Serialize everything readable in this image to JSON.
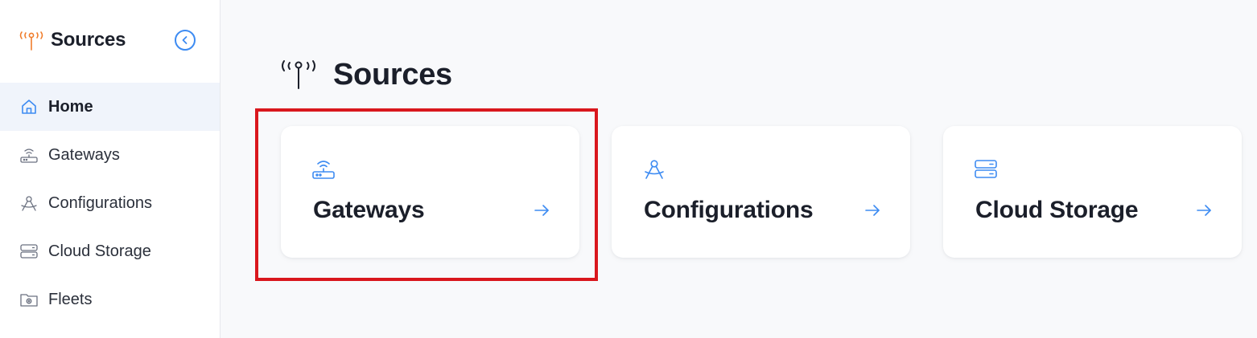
{
  "sidebar": {
    "title": "Sources",
    "logo_icon": "antenna-icon",
    "collapse_icon": "chevron-left-circle-icon",
    "items": [
      {
        "label": "Home",
        "icon": "home-icon",
        "active": true
      },
      {
        "label": "Gateways",
        "icon": "router-icon",
        "active": false
      },
      {
        "label": "Configurations",
        "icon": "compass-icon",
        "active": false
      },
      {
        "label": "Cloud Storage",
        "icon": "server-icon",
        "active": false
      },
      {
        "label": "Fleets",
        "icon": "folder-gear-icon",
        "active": false
      }
    ]
  },
  "main": {
    "title": "Sources",
    "title_icon": "antenna-icon",
    "cards": [
      {
        "label": "Gateways",
        "icon": "router-icon",
        "highlighted": true
      },
      {
        "label": "Configurations",
        "icon": "compass-icon",
        "highlighted": false
      },
      {
        "label": "Cloud Storage",
        "icon": "server-icon",
        "highlighted": false
      }
    ]
  },
  "colors": {
    "accent": "#3d8bf2",
    "brand_orange": "#f07d2c",
    "highlight": "#d9171d",
    "text": "#1b1f2a"
  }
}
